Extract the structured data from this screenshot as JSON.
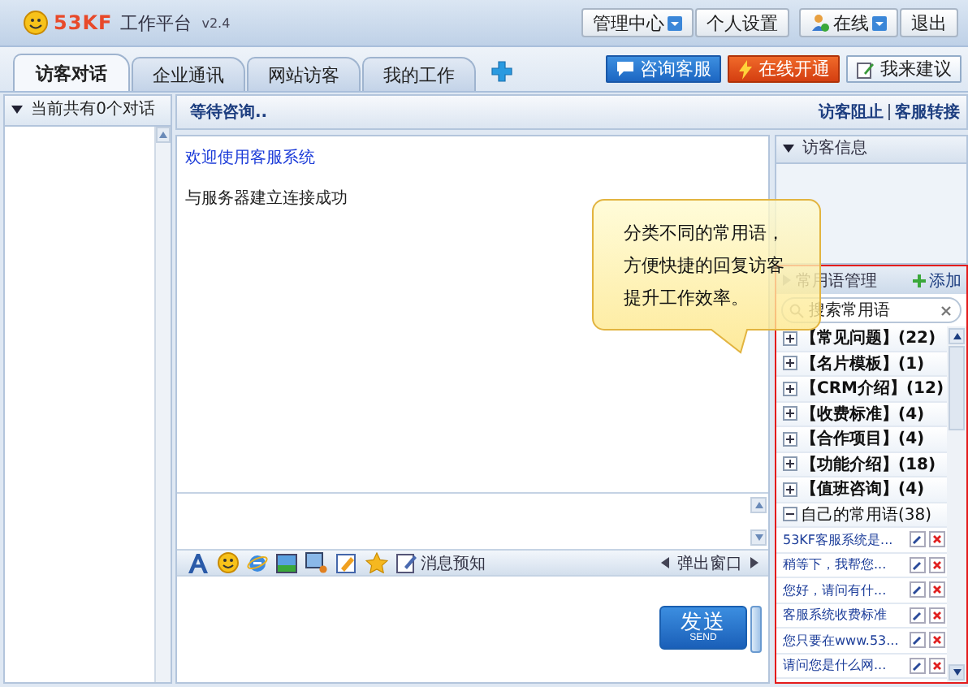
{
  "header": {
    "logo": "53KF",
    "title": "工作平台",
    "version": "v2.4",
    "buttons": [
      {
        "label": "管理中心",
        "kind": "dropdown"
      },
      {
        "label": "个人设置",
        "kind": "plain"
      },
      {
        "label": "在线",
        "kind": "status"
      },
      {
        "label": "退出",
        "kind": "plain"
      }
    ]
  },
  "tabs": [
    {
      "label": "访客对话",
      "selected": true
    },
    {
      "label": "企业通讯",
      "selected": false
    },
    {
      "label": "网站访客",
      "selected": false
    },
    {
      "label": "我的工作",
      "selected": false
    }
  ],
  "action_buttons": [
    {
      "label": "咨询客服",
      "kind": "chat"
    },
    {
      "label": "在线开通",
      "kind": "open"
    },
    {
      "label": "我来建议",
      "kind": "suggest"
    }
  ],
  "sessions": {
    "header": "当前共有0个对话"
  },
  "chat": {
    "status": "等待咨询..",
    "links": [
      "访客阻止",
      "客服转接"
    ],
    "messages": [
      {
        "text": "欢迎使用客服系统",
        "kind": "system"
      },
      {
        "text": "与服务器建立连接成功",
        "kind": "info"
      }
    ],
    "toolbar_label": "消息预知",
    "popup_label": "弹出窗口",
    "send": {
      "label": "发送",
      "sublabel": "SEND"
    }
  },
  "visitor_info": {
    "title": "访客信息"
  },
  "phrases": {
    "title": "常用语管理",
    "add": "添加",
    "search": {
      "placeholder": "搜索常用语"
    },
    "groups": [
      {
        "label": "【常见问题】(22)",
        "expanded": false
      },
      {
        "label": "【名片模板】(1)",
        "expanded": false
      },
      {
        "label": "【CRM介绍】(12)",
        "expanded": false
      },
      {
        "label": "【收费标准】(4)",
        "expanded": false
      },
      {
        "label": "【合作项目】(4)",
        "expanded": false
      },
      {
        "label": "【功能介绍】(18)",
        "expanded": false
      },
      {
        "label": "【值班咨询】(4)",
        "expanded": false
      },
      {
        "label": "自己的常用语(38)",
        "expanded": true,
        "children": [
          {
            "text": "53KF客服系统是..."
          },
          {
            "text": "稍等下，我帮您..."
          },
          {
            "text": "您好，请问有什..."
          },
          {
            "text": "客服系统收费标准"
          },
          {
            "text": "您只要在www.53..."
          },
          {
            "text": "请问您是什么网..."
          }
        ]
      }
    ]
  },
  "tooltip": {
    "lines": [
      "分类不同的常用语，",
      "方便快捷的回复访客",
      "提升工作效率。"
    ]
  }
}
